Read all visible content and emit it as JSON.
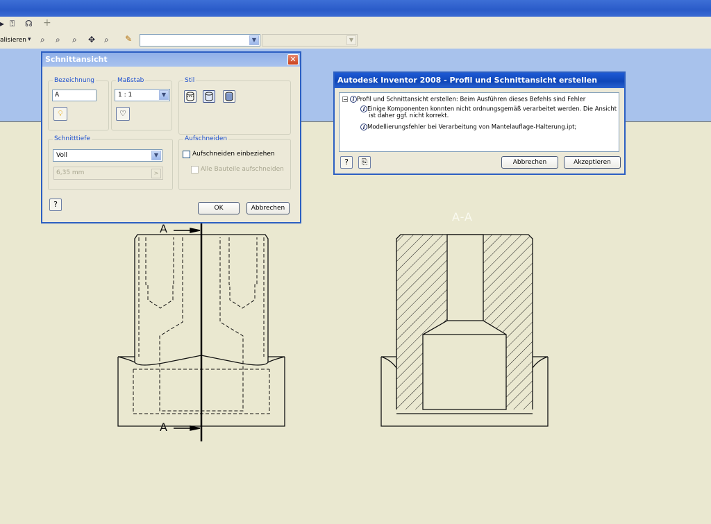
{
  "toolbar": {
    "partial_label": "alisieren",
    "style_combo_value": "",
    "layer_combo_value": ""
  },
  "section_dialog": {
    "title": "Schnittansicht",
    "bezeichnung_label": "Bezeichnung",
    "bezeichnung_value": "A",
    "massstab_label": "Maßstab",
    "massstab_value": "1 : 1",
    "stil_label": "Stil",
    "schnitttiefe_label": "Schnitttiefe",
    "schnitttiefe_value": "Voll",
    "depth_value": "6,35 mm",
    "aufschneiden_label": "Aufschneiden",
    "aufschneiden_einbeziehen": "Aufschneiden einbeziehen",
    "alle_bauteile": "Alle Bauteile aufschneiden",
    "ok_label": "OK",
    "cancel_label": "Abbrechen"
  },
  "error_dialog": {
    "title": "Autodesk Inventor 2008 - Profil und Schnittansicht erstellen",
    "root_message": "Profil und Schnittansicht erstellen: Beim Ausführen dieses Befehls sind Fehler",
    "msg1_line1": "Einige Komponenten konnten nicht ordnungsgemäß verarbeitet werden. Die Ansicht",
    "msg1_line2": "ist daher ggf. nicht korrekt.",
    "msg2": "Modellierungsfehler bei Verarbeitung von Mantelauflage-Halterung.ipt;",
    "abbrechen_label": "Abbrechen",
    "akzeptieren_label": "Akzeptieren"
  },
  "drawing": {
    "section_title": "A-A",
    "marker_top": "A",
    "marker_bottom": "A"
  },
  "colors": {
    "sheet_background": "#eae8d0",
    "title_bar": "#0f46b8",
    "dialog_face": "#ece9d8",
    "group_label": "#1c4fcf"
  }
}
